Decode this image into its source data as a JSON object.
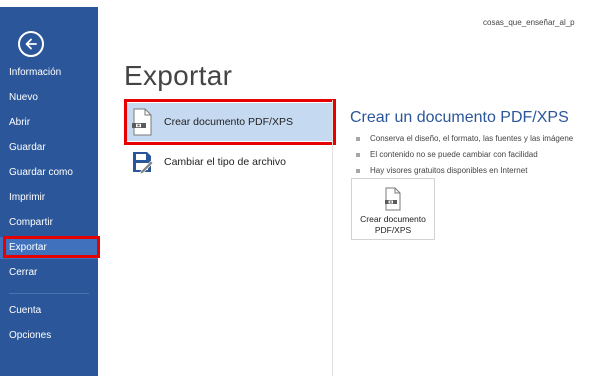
{
  "window": {
    "document_name": "cosas_que_enseñar_al_p"
  },
  "nav": {
    "items": [
      {
        "label": "Información"
      },
      {
        "label": "Nuevo"
      },
      {
        "label": "Abrir"
      },
      {
        "label": "Guardar"
      },
      {
        "label": "Guardar como"
      },
      {
        "label": "Imprimir"
      },
      {
        "label": "Compartir"
      },
      {
        "label": "Exportar",
        "selected": true
      },
      {
        "label": "Cerrar"
      },
      {
        "label": "Cuenta"
      },
      {
        "label": "Opciones"
      }
    ]
  },
  "main": {
    "title": "Exportar",
    "options": [
      {
        "label": "Crear documento PDF/XPS",
        "icon": "pdf-document-icon",
        "selected": true
      },
      {
        "label": "Cambiar el tipo de archivo",
        "icon": "change-file-type-icon",
        "selected": false
      }
    ]
  },
  "detail": {
    "title": "Crear un documento PDF/XPS",
    "bullets": [
      "Conserva el diseño, el formato, las fuentes y las imágene",
      "El contenido no se puede cambiar con facilidad",
      "Hay visores gratuitos disponibles en Internet"
    ],
    "button": {
      "line1": "Crear documento",
      "line2": "PDF/XPS"
    }
  },
  "colors": {
    "nav_background": "#2b579a",
    "nav_selected": "#3f71bd",
    "option_selected": "#c5d9f1",
    "accent_title": "#2b579a",
    "highlight_box": "#e60000"
  }
}
